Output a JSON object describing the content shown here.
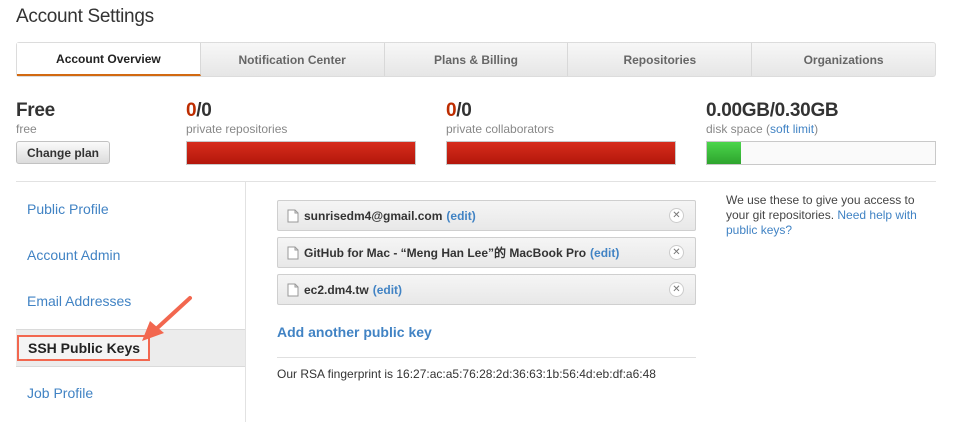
{
  "page": {
    "title": "Account Settings"
  },
  "tabs": [
    {
      "label": "Account Overview",
      "active": true
    },
    {
      "label": "Notification Center"
    },
    {
      "label": "Plans & Billing"
    },
    {
      "label": "Repositories"
    },
    {
      "label": "Organizations"
    }
  ],
  "plan": {
    "name": "Free",
    "sub": "free",
    "change_label": "Change plan"
  },
  "stats": {
    "private_repos": {
      "used": "0",
      "total": "/0",
      "label": "private repositories",
      "fill_fraction": 1.0
    },
    "private_collaborators": {
      "used": "0",
      "total": "/0",
      "label": "private collaborators",
      "fill_fraction": 1.0
    },
    "disk": {
      "used": "0.00GB",
      "total": "/0.30GB",
      "label": "disk space",
      "soft_limit_prefix": "(",
      "soft_limit_link": "soft limit",
      "soft_limit_suffix": ")",
      "fill_fraction": 0.15
    }
  },
  "sidebar": {
    "items": [
      {
        "label": "Public Profile"
      },
      {
        "label": "Account Admin"
      },
      {
        "label": "Email Addresses"
      },
      {
        "label": "SSH Public Keys",
        "selected": true
      },
      {
        "label": "Job Profile"
      }
    ]
  },
  "keys": [
    {
      "title": "sunrisedm4@gmail.com",
      "edit_label": "(edit)"
    },
    {
      "title": "GitHub for Mac - “Meng Han Lee”的 MacBook Pro",
      "edit_label": "(edit)"
    },
    {
      "title": "ec2.dm4.tw",
      "edit_label": "(edit)"
    }
  ],
  "add_key_label": "Add another public key",
  "fingerprint": "Our RSA fingerprint is 16:27:ac:a5:76:28:2d:36:63:1b:56:4d:eb:df:a6:48",
  "help": {
    "text": "We use these to give you access to your git repositories. ",
    "link": "Need help with public keys?"
  },
  "colors": {
    "accent": "#d26911",
    "link": "#4183c4",
    "danger": "#bd2c00",
    "highlight_box": "#f2674f"
  }
}
